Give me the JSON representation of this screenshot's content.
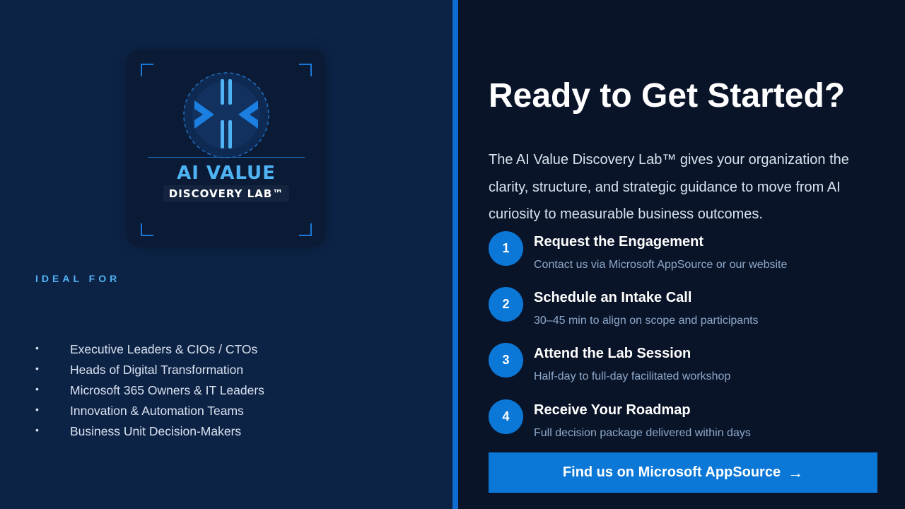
{
  "logo": {
    "title": "AI VALUE",
    "subtitle": "DISCOVERY LAB™"
  },
  "ideal_for": {
    "label": "IDEAL FOR",
    "items": [
      "Executive Leaders & CIOs / CTOs",
      "Heads of Digital Transformation",
      "Microsoft 365 Owners & IT Leaders",
      "Innovation & Automation Teams",
      "Business Unit Decision-Makers"
    ]
  },
  "main": {
    "heading": "Ready to Get Started?",
    "intro": "The AI Value Discovery Lab™ gives your organization the clarity, structure, and strategic guidance to move from AI curiosity to measurable business outcomes.",
    "steps": [
      {
        "number": "1",
        "title": "Request the Engagement",
        "description": "Contact us via Microsoft AppSource or our website"
      },
      {
        "number": "2",
        "title": "Schedule an Intake Call",
        "description": "30–45 min to align on scope and participants"
      },
      {
        "number": "3",
        "title": "Attend the Lab Session",
        "description": "Half-day to full-day facilitated workshop"
      },
      {
        "number": "4",
        "title": "Receive Your Roadmap",
        "description": "Full decision package delivered within days"
      }
    ],
    "cta_label": "Find us on Microsoft AppSource",
    "cta_arrow": "→"
  },
  "colors": {
    "accent": "#0b78d8",
    "left_bg": "#0d2346",
    "right_bg": "#0a1428",
    "label_blue": "#4fb3f3"
  }
}
